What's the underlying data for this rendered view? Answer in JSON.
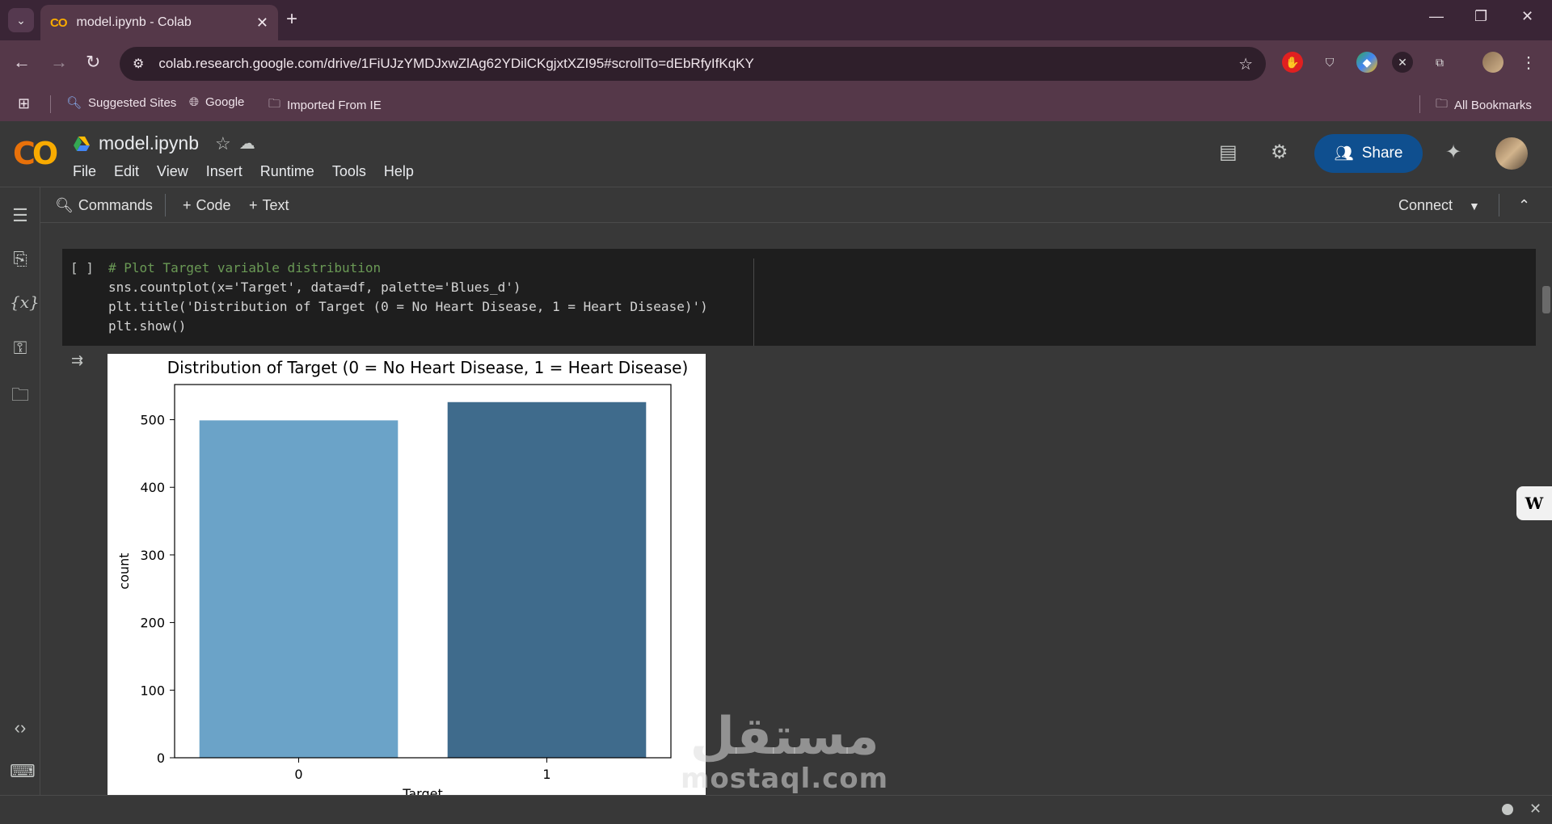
{
  "browser": {
    "tab_title": "model.ipynb - Colab",
    "tab_favicon": "CO",
    "url": "colab.research.google.com/drive/1FiUJzYMDJxwZlAg62YDilCKgjxtXZI95#scrollTo=dEbRfyIfKqKY",
    "bookmarks": [
      "Suggested Sites",
      "Google",
      "Imported From IE"
    ],
    "all_bookmarks": "All Bookmarks"
  },
  "colab": {
    "logo": "CO",
    "notebook_name": "model.ipynb",
    "menu": [
      "File",
      "Edit",
      "View",
      "Insert",
      "Runtime",
      "Tools",
      "Help"
    ],
    "share_label": "Share",
    "toolbar": {
      "commands": "Commands",
      "add_code": "Code",
      "add_text": "Text",
      "connect": "Connect"
    }
  },
  "cell": {
    "bracket": "[ ]",
    "code_lines": [
      "# Plot Target variable distribution",
      "sns.countplot(x='Target', data=df, palette='Blues_d')",
      "plt.title('Distribution of Target (0 = No Heart Disease, 1 = Heart Disease)')",
      "plt.show()"
    ]
  },
  "chart_data": {
    "type": "bar",
    "title": "Distribution of Target (0 = No Heart Disease, 1 = Heart Disease)",
    "xlabel": "Target",
    "ylabel": "count",
    "categories": [
      "0",
      "1"
    ],
    "values": [
      499,
      526
    ],
    "ylim": [
      0,
      552
    ],
    "yticks": [
      0,
      100,
      200,
      300,
      400,
      500
    ],
    "colors": [
      "#6ba3c8",
      "#3f6b8c"
    ],
    "grid": false
  },
  "watermark": {
    "arabic": "مستقل",
    "latin": "mostaql.com"
  },
  "colors": {
    "accent": "#0f4f8f",
    "tab_bg": "#553849",
    "colab_orange": "#f9ab00"
  }
}
